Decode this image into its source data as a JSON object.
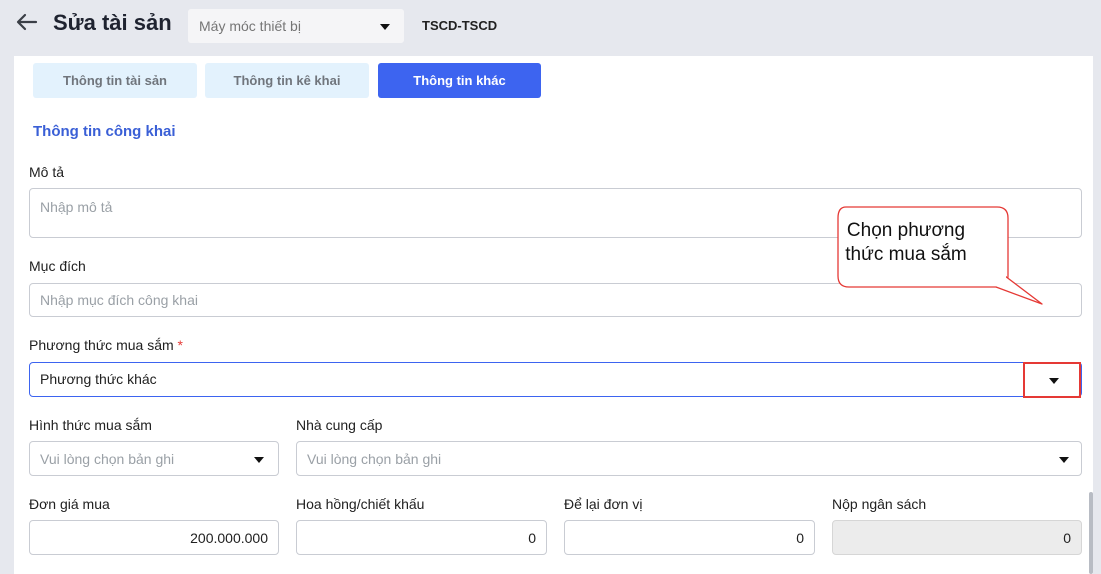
{
  "header": {
    "title": "Sửa tài sản",
    "category_value": "Máy móc thiết bị",
    "asset_code": "TSCD-TSCD",
    "icons": {
      "back": "arrow-left-icon",
      "dropdown": "caret-down-icon"
    }
  },
  "tabs": [
    {
      "label": "Thông tin tài sản",
      "active": false
    },
    {
      "label": "Thông tin kê khai",
      "active": false
    },
    {
      "label": "Thông tin khác",
      "active": true
    }
  ],
  "section": {
    "title": "Thông tin công khai"
  },
  "fields": {
    "description": {
      "label": "Mô tả",
      "placeholder": "Nhập mô tả"
    },
    "purpose": {
      "label": "Mục đích",
      "placeholder": "Nhập mục đích công khai"
    },
    "purchase_method": {
      "label": "Phương thức mua sắm",
      "required_mark": "*",
      "value": "Phương thức khác"
    },
    "purchase_form": {
      "label": "Hình thức mua sắm",
      "placeholder": "Vui lòng chọn bản ghi"
    },
    "supplier": {
      "label": "Nhà cung cấp",
      "placeholder": "Vui lòng chọn bản ghi"
    },
    "unit_price": {
      "label": "Đơn giá mua",
      "value": "200.000.000"
    },
    "commission": {
      "label": "Hoa hồng/chiết khấu",
      "value": "0"
    },
    "retained_unit": {
      "label": "Để lại đơn vị",
      "value": "0"
    },
    "budget_payment": {
      "label": "Nộp ngân sách",
      "value": "0"
    }
  },
  "callout": {
    "text_line1": "Chọn phương",
    "text_line2": "thức mua sắm"
  },
  "colors": {
    "accent": "#3d64f0",
    "section_title": "#3a5fd6",
    "highlight": "#e53935",
    "tab_inactive_bg": "#e3f2fd"
  }
}
